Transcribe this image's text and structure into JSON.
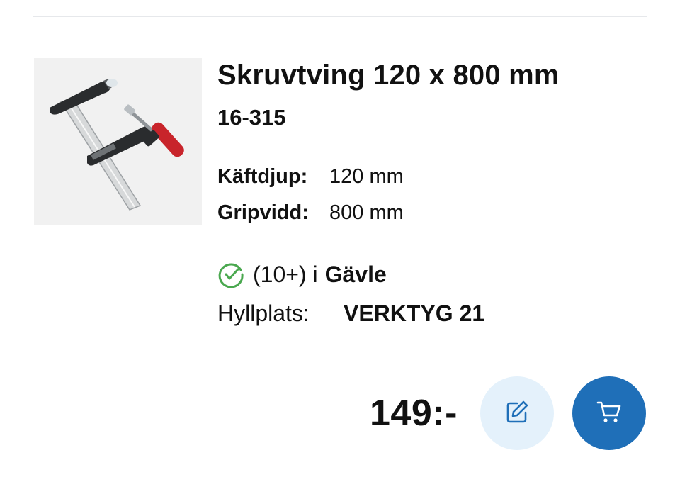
{
  "product": {
    "name": "Skruvtving 120 x 800 mm",
    "sku": "16-315",
    "specs": [
      {
        "label": "Käftdjup:",
        "value": "120 mm"
      },
      {
        "label": "Gripvidd:",
        "value": "800 mm"
      }
    ],
    "stock": {
      "count": "(10+) i",
      "location": "Gävle",
      "status_color": "#4aa84f"
    },
    "shelf": {
      "label": "Hyllplats:",
      "value": "VERKTYG 21"
    },
    "price": "149:-"
  },
  "actions": {
    "edit_icon": "edit-icon",
    "cart_icon": "cart-icon"
  },
  "colors": {
    "accent": "#1f6fb8",
    "accent_light": "#e4f1fb",
    "divider": "#e6e8eb"
  }
}
